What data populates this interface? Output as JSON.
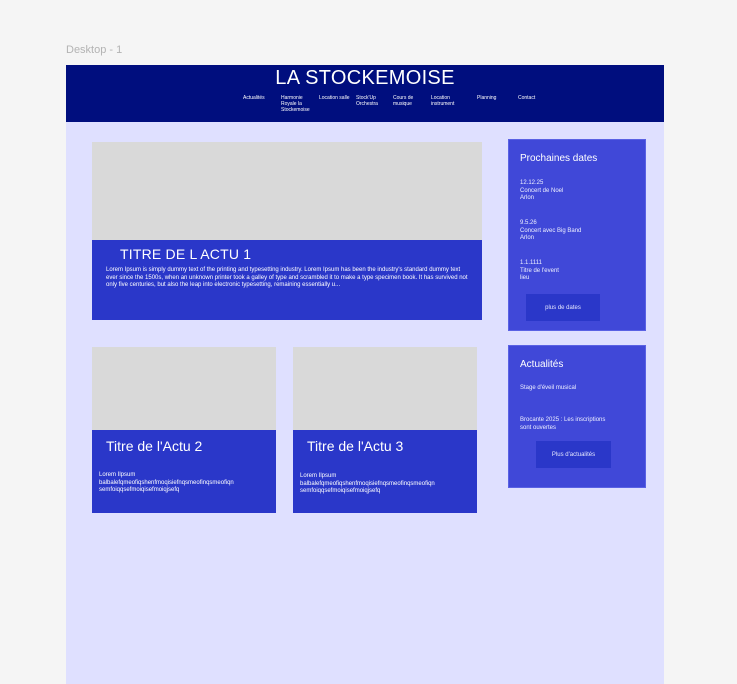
{
  "canvas": {
    "frame_label": "Desktop - 1"
  },
  "header": {
    "title": "LA STOCKEMOISE",
    "nav": [
      "Actualités",
      "Harmonie\nRoyale la\nStockemoise",
      "Location salle",
      "Stock'Up\nOrchestra",
      "Cours de\nmusique",
      "Location\ninstrument",
      "Planning",
      "Contact"
    ]
  },
  "featured": {
    "title": "TITRE DE L ACTU 1",
    "text": "Lorem Ipsum is simply dummy text of the printing and  typesetting industry. Lorem Ipsum has been the industry's standard dummy text ever since the 1500s, when an unknown printer took a galley of  type and scrambled it to make a type specimen book. It has survived not  only five centuries, but also the leap into electronic typesetting, remaining essentially u..."
  },
  "cards": [
    {
      "title": "Titre de l'Actu 2",
      "text": "Lorem Ilpsum balbalefqmeofiqshenfmoqisiefnqsmeofinqsmeofiqn semfoiqqsefmoiqisefmoiqjsefq"
    },
    {
      "title": "Titre de l'Actu 3",
      "text": "Lorem Ilpsum balbalefqmeofiqshenfmoqisiefnqsmeofinqsmeofiqn semfoiqqsefmoiqisefmoiqjsefq"
    }
  ],
  "dates": {
    "heading": "Prochaines dates",
    "items": [
      "12.12.25\nConcert de Noel\nArlon",
      "9.5.26\nConcert avec Big Band\nArlon",
      "1.1.1111\nTitre de l'event\nlieu"
    ],
    "button": "plus de dates"
  },
  "news": {
    "heading": "Actualités",
    "items": [
      "Stage d'éveil musical",
      "Brocante 2025 : Les inscriptions\nsont ouvertes"
    ],
    "button": "Plus d'actualités"
  },
  "colors": {
    "header": "#000e7e",
    "background": "#dfe0ff",
    "card": "#2a37c9",
    "sidebar": "#4048d8",
    "placeholder": "#d9d9d9"
  }
}
